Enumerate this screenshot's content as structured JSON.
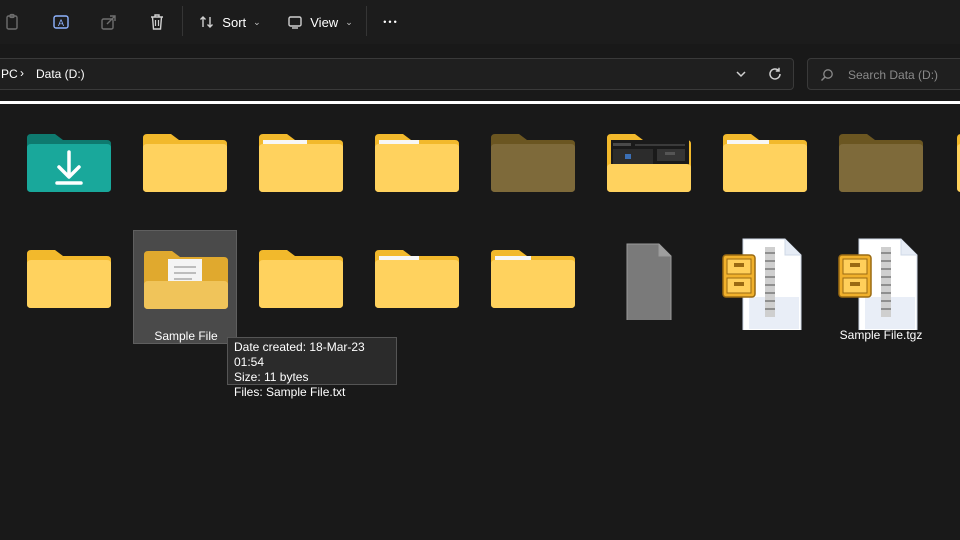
{
  "toolbar": {
    "sort_label": "Sort",
    "view_label": "View",
    "more_label": "•••"
  },
  "address": {
    "crumbs": [
      "PC",
      "Data (D:)"
    ],
    "separator": "›"
  },
  "search": {
    "placeholder": "Search Data (D:)"
  },
  "items": [
    {
      "name": "",
      "icon": "downloads-folder-icon"
    },
    {
      "name": "",
      "icon": "folder-icon"
    },
    {
      "name": "",
      "icon": "folder-icon"
    },
    {
      "name": "",
      "icon": "folder-icon"
    },
    {
      "name": "",
      "icon": "dimmed-folder-icon"
    },
    {
      "name": "",
      "icon": "folder-with-preview-icon"
    },
    {
      "name": "",
      "icon": "folder-icon"
    },
    {
      "name": "",
      "icon": "dimmed-folder-icon"
    },
    {
      "name": "",
      "icon": "folder-icon"
    },
    {
      "name": "Sample File",
      "icon": "folder-with-document-icon",
      "selected": true
    },
    {
      "name": "",
      "icon": "folder-icon"
    },
    {
      "name": "",
      "icon": "folder-icon"
    },
    {
      "name": "",
      "icon": "folder-icon"
    },
    {
      "name": "",
      "icon": "blank-file-icon"
    },
    {
      "name": "",
      "icon": "archive-file-icon"
    },
    {
      "name": "Sample File.tgz",
      "icon": "archive-file-icon"
    }
  ],
  "tooltip": {
    "date_created": "Date created: 18-Mar-23 01:54",
    "size": "Size: 11 bytes",
    "files": "Files: Sample File.txt"
  },
  "colors": {
    "background": "#191919",
    "folder_yellow": "#ffd25e",
    "folder_tab": "#f2b92c",
    "downloads_teal": "#19a89b",
    "selection": "#4a4a4a"
  }
}
